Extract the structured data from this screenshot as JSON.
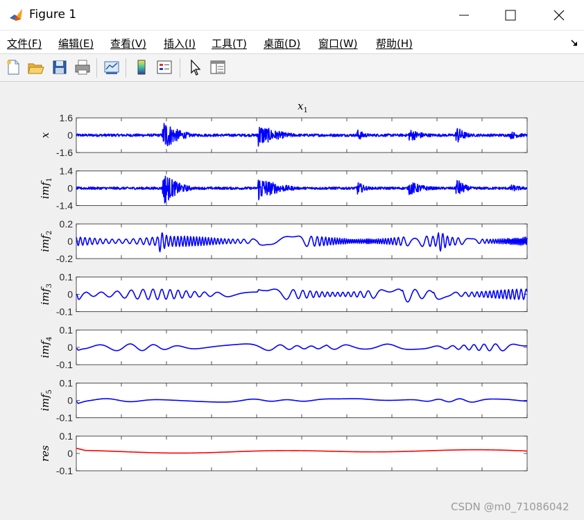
{
  "window": {
    "title": "Figure 1"
  },
  "menu": {
    "items": [
      "文件(F)",
      "编辑(E)",
      "查看(V)",
      "插入(I)",
      "工具(T)",
      "桌面(D)",
      "窗口(W)",
      "帮助(H)"
    ]
  },
  "toolbar": {
    "icons": [
      "new-figure-icon",
      "open-file-icon",
      "save-icon",
      "print-icon",
      "link-plot-icon",
      "insert-colorbar-icon",
      "insert-legend-icon",
      "edit-plot-icon",
      "property-inspector-icon"
    ]
  },
  "watermark": "CSDN @m0_71086042",
  "chart_data": {
    "type": "line",
    "title": "x_1",
    "x_range": [
      0,
      10
    ],
    "x_ticks_count": 11,
    "x_tick_labels_shown": false,
    "grid": false,
    "panels": [
      {
        "ylabel_main": "x",
        "ylabel_sub": "",
        "yticks": [
          "1.6",
          "0",
          "-1.6"
        ],
        "ylim": [
          -1.6,
          1.6
        ],
        "color": "#0000ff",
        "type": "noise",
        "base_amp": 0.12,
        "bursts": [
          [
            1.9,
            2.3,
            1.55
          ],
          [
            4.0,
            4.6,
            1.1
          ],
          [
            6.2,
            6.4,
            0.55
          ],
          [
            7.35,
            7.8,
            0.6
          ],
          [
            8.4,
            8.6,
            0.9
          ],
          [
            9.6,
            10,
            0.35
          ]
        ]
      },
      {
        "ylabel_main": "imf",
        "ylabel_sub": "1",
        "yticks": [
          "1.4",
          "0",
          "-1.4"
        ],
        "ylim": [
          -1.4,
          1.4
        ],
        "color": "#0000ff",
        "type": "noise",
        "base_amp": 0.1,
        "bursts": [
          [
            1.9,
            2.3,
            1.4
          ],
          [
            4.0,
            4.6,
            1.05
          ],
          [
            6.2,
            6.4,
            0.55
          ],
          [
            7.35,
            7.8,
            0.6
          ],
          [
            8.4,
            8.6,
            0.85
          ],
          [
            9.6,
            10,
            0.3
          ]
        ]
      },
      {
        "ylabel_main": "imf",
        "ylabel_sub": "2",
        "yticks": [
          "0.2",
          "0",
          "-0.2"
        ],
        "ylim": [
          -0.2,
          0.2
        ],
        "color": "#0000ff",
        "type": "osc",
        "freq": 9.0,
        "base_amp": 0.06,
        "bursts": [
          [
            1.8,
            2.1,
            0.15
          ],
          [
            4.0,
            4.4,
            0.12
          ],
          [
            6.4,
            6.8,
            0.1
          ],
          [
            8.0,
            8.4,
            0.14
          ]
        ]
      },
      {
        "ylabel_main": "imf",
        "ylabel_sub": "3",
        "yticks": [
          "0.1",
          "0",
          "-0.1"
        ],
        "ylim": [
          -0.1,
          0.1
        ],
        "color": "#0000ff",
        "type": "osc",
        "freq": 3.6,
        "base_amp": 0.03,
        "bursts": [
          [
            0,
            0.1,
            0.08
          ],
          [
            4.0,
            4.4,
            0.06
          ],
          [
            7.2,
            7.8,
            0.06
          ],
          [
            7.9,
            8.2,
            0.1
          ]
        ]
      },
      {
        "ylabel_main": "imf",
        "ylabel_sub": "4",
        "yticks": [
          "0.1",
          "0",
          "-0.1"
        ],
        "ylim": [
          -0.1,
          0.1
        ],
        "color": "#0000ff",
        "type": "osc",
        "freq": 1.4,
        "base_amp": 0.02,
        "bursts": [
          [
            0,
            0.15,
            0.04
          ],
          [
            5.5,
            6.0,
            0.03
          ]
        ]
      },
      {
        "ylabel_main": "imf",
        "ylabel_sub": "5",
        "yticks": [
          "0.1",
          "0",
          "-0.1"
        ],
        "ylim": [
          -0.1,
          0.1
        ],
        "color": "#0000ff",
        "type": "osc",
        "freq": 0.7,
        "base_amp": 0.01,
        "bursts": [
          [
            0,
            0.3,
            0.025
          ]
        ]
      },
      {
        "ylabel_main": "res",
        "ylabel_sub": "",
        "yticks": [
          "0.1",
          "0",
          "-0.1"
        ],
        "ylim": [
          -0.1,
          0.1
        ],
        "color": "#ff0000",
        "type": "trend"
      }
    ]
  }
}
